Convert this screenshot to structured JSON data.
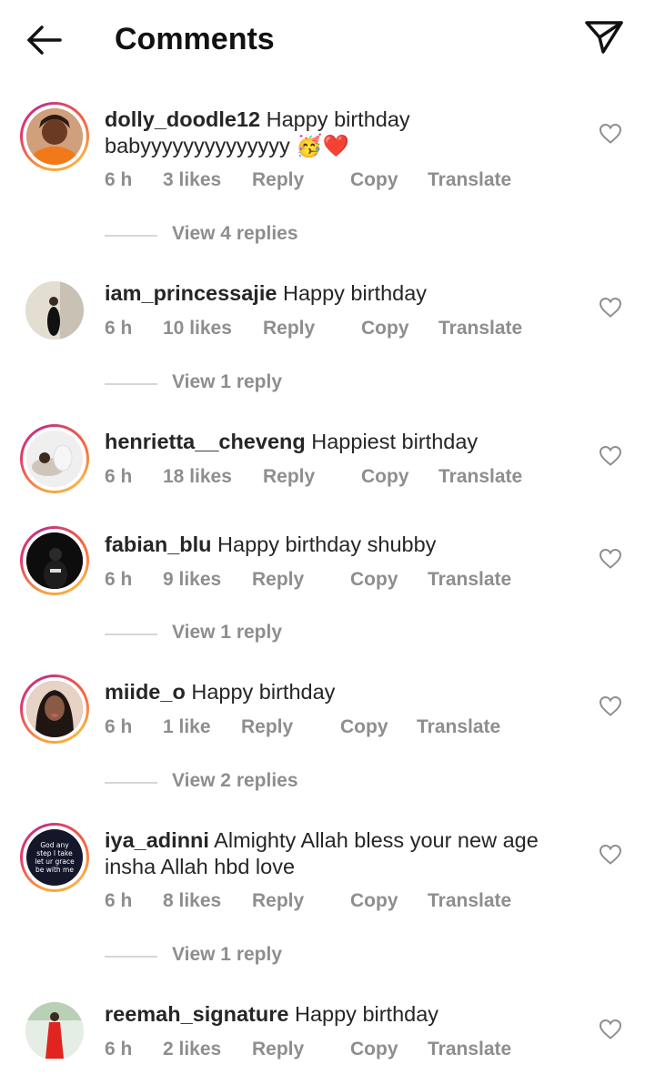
{
  "header": {
    "title": "Comments",
    "back_icon": "arrow-left-icon",
    "send_icon": "paper-plane-icon"
  },
  "comments": [
    {
      "username": "dolly_doodle12",
      "text": "Happy birthday babyyyyyyyyyyyyyy 🥳❤️",
      "time": "6 h",
      "likes": "3 likes",
      "reply": "Reply",
      "copy": "Copy",
      "translate": "Translate",
      "view_replies": "View 4 replies"
    },
    {
      "username": "iam_princessajie",
      "text": "Happy birthday",
      "time": "6 h",
      "likes": "10 likes",
      "reply": "Reply",
      "copy": "Copy",
      "translate": "Translate",
      "view_replies": "View 1 reply"
    },
    {
      "username": "henrietta__cheveng",
      "text": "Happiest birthday",
      "time": "6 h",
      "likes": "18 likes",
      "reply": "Reply",
      "copy": "Copy",
      "translate": "Translate"
    },
    {
      "username": "fabian_blu",
      "text": "Happy birthday shubby",
      "time": "6 h",
      "likes": "9 likes",
      "reply": "Reply",
      "copy": "Copy",
      "translate": "Translate",
      "view_replies": "View 1 reply"
    },
    {
      "username": "miide_o",
      "text": "Happy birthday",
      "time": "6 h",
      "likes": "1 like",
      "reply": "Reply",
      "copy": "Copy",
      "translate": "Translate",
      "view_replies": "View 2 replies"
    },
    {
      "username": "iya_adinni",
      "text": "Almighty Allah bless your new age insha Allah hbd love",
      "time": "6 h",
      "likes": "8 likes",
      "reply": "Reply",
      "copy": "Copy",
      "translate": "Translate",
      "view_replies": "View 1 reply",
      "avatar_text": "God any step I take let ur grace be with me"
    },
    {
      "username": "reemah_signature",
      "text": "Happy birthday",
      "time": "6 h",
      "likes": "2 likes",
      "reply": "Reply",
      "copy": "Copy",
      "translate": "Translate"
    }
  ],
  "colors": {
    "text": "#262626",
    "muted": "#8e8e8e",
    "ring_start": "#f9a13a",
    "ring_end": "#c13584"
  }
}
